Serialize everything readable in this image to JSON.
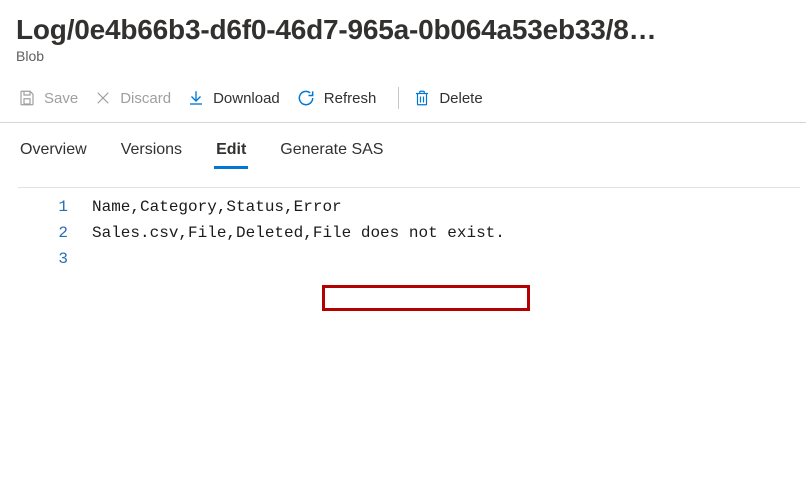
{
  "header": {
    "title": "Log/0e4b66b3-d6f0-46d7-965a-0b064a53eb33/8…",
    "subtitle": "Blob"
  },
  "toolbar": {
    "save": "Save",
    "discard": "Discard",
    "download": "Download",
    "refresh": "Refresh",
    "delete": "Delete"
  },
  "tabs": {
    "overview": "Overview",
    "versions": "Versions",
    "edit": "Edit",
    "generate_sas": "Generate SAS"
  },
  "editor": {
    "lines": {
      "n1": "1",
      "n2": "2",
      "n3": "3",
      "l1": "Name,Category,Status,Error",
      "l2_a": "Sales.csv,File,Deleted,",
      "l2_b": "File does not exist.",
      "l3": ""
    }
  },
  "highlight": {
    "left": "322",
    "top": "285",
    "width": "208",
    "height": "26"
  }
}
